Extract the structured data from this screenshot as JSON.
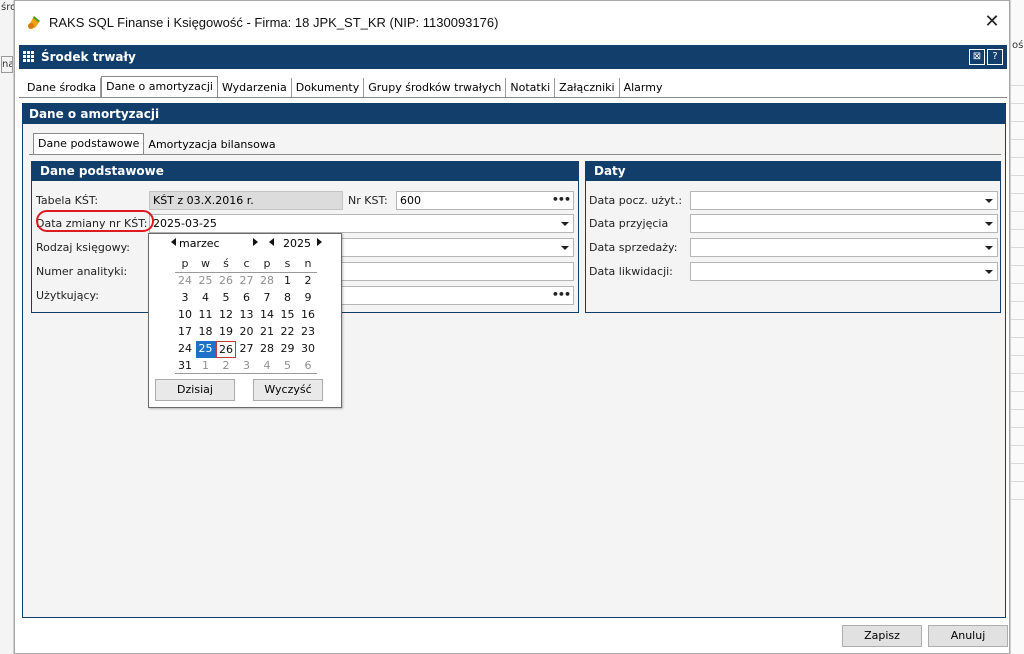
{
  "background": {
    "left_fragment_top": "śro",
    "left_fragment_field": "nal",
    "right_fragment": "ośc"
  },
  "window": {
    "title": "RAKS SQL Finanse i Księgowość - Firma: 18 JPK_ST_KR (NIP: 1130093176)",
    "close_glyph": "✕"
  },
  "header": {
    "title": "Środek trwały",
    "btn1_glyph": "⊠",
    "btn2_glyph": "?"
  },
  "tabs": [
    {
      "label": "Dane środka"
    },
    {
      "label": "Dane o amortyzacji",
      "active": true
    },
    {
      "label": "Wydarzenia"
    },
    {
      "label": "Dokumenty"
    },
    {
      "label": "Grupy środków trwałych"
    },
    {
      "label": "Notatki"
    },
    {
      "label": "Załączniki"
    },
    {
      "label": "Alarmy"
    }
  ],
  "section": {
    "title": "Dane o amortyzacji",
    "sub_tabs": [
      {
        "label": "Dane podstawowe",
        "active": true
      },
      {
        "label": "Amortyzacja bilansowa"
      }
    ]
  },
  "basic": {
    "title": "Dane podstawowe",
    "kst_table_label": "Tabela KŚT:",
    "kst_table_value": "KŚT z 03.X.2016 r.",
    "kst_no_label": "Nr KST:",
    "kst_no_value": "600",
    "kst_change_label": "Data zmiany nr KŚT:",
    "kst_change_value": "2025-03-25",
    "accounting_type_label": "Rodzaj księgowy:",
    "analytic_no_label": "Numer analityki:",
    "user_label": "Użytkujący:",
    "dots": "•••"
  },
  "dates": {
    "title": "Daty",
    "start_use_label": "Data pocz. użyt.:",
    "acceptance_label": "Data przyjęcia",
    "sale_label": "Data sprzedaży:",
    "liquidation_label": "Data likwidacji:"
  },
  "calendar": {
    "month": "marzec",
    "year": "2025",
    "weekdays": [
      "p",
      "w",
      "ś",
      "c",
      "p",
      "s",
      "n"
    ],
    "weeks": [
      [
        {
          "d": "24",
          "m": 1
        },
        {
          "d": "25",
          "m": 1
        },
        {
          "d": "26",
          "m": 1
        },
        {
          "d": "27",
          "m": 1
        },
        {
          "d": "28",
          "m": 1
        },
        {
          "d": "1"
        },
        {
          "d": "2"
        }
      ],
      [
        {
          "d": "3"
        },
        {
          "d": "4"
        },
        {
          "d": "5"
        },
        {
          "d": "6"
        },
        {
          "d": "7"
        },
        {
          "d": "8"
        },
        {
          "d": "9"
        }
      ],
      [
        {
          "d": "10"
        },
        {
          "d": "11"
        },
        {
          "d": "12"
        },
        {
          "d": "13"
        },
        {
          "d": "14"
        },
        {
          "d": "15"
        },
        {
          "d": "16"
        }
      ],
      [
        {
          "d": "17"
        },
        {
          "d": "18"
        },
        {
          "d": "19"
        },
        {
          "d": "20"
        },
        {
          "d": "21"
        },
        {
          "d": "22"
        },
        {
          "d": "23"
        }
      ],
      [
        {
          "d": "24"
        },
        {
          "d": "25",
          "sel": 1
        },
        {
          "d": "26",
          "today": 1
        },
        {
          "d": "27"
        },
        {
          "d": "28"
        },
        {
          "d": "29"
        },
        {
          "d": "30"
        }
      ],
      [
        {
          "d": "31"
        },
        {
          "d": "1",
          "m": 1
        },
        {
          "d": "2",
          "m": 1
        },
        {
          "d": "3",
          "m": 1
        },
        {
          "d": "4",
          "m": 1
        },
        {
          "d": "5",
          "m": 1
        },
        {
          "d": "6",
          "m": 1
        }
      ]
    ],
    "today_btn": "Dzisiaj",
    "clear_btn": "Wyczyść"
  },
  "footer": {
    "save": "Zapisz",
    "cancel": "Anuluj"
  },
  "colors": {
    "header_blue": "#123e6b",
    "selected_day": "#1e73c8",
    "highlight_red": "#e0191f"
  }
}
